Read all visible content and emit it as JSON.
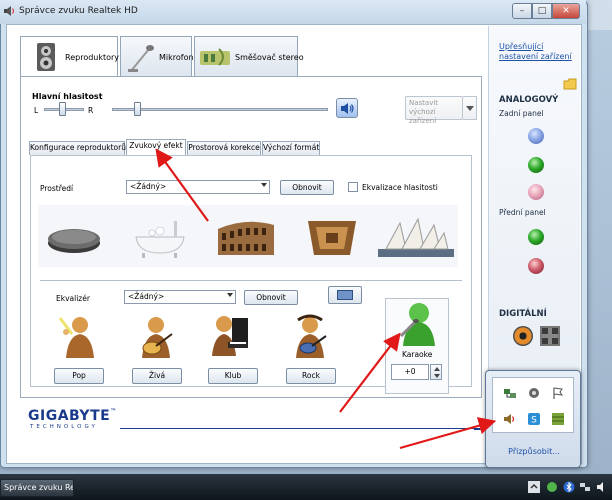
{
  "window": {
    "title": "Správce zvuku Realtek HD",
    "min_label": "–",
    "max_label": "□",
    "close_label": "✕"
  },
  "main_tabs": [
    {
      "label": "Reproduktory"
    },
    {
      "label": "Mikrofon"
    },
    {
      "label": "Směšovač stereo"
    }
  ],
  "volume": {
    "title": "Hlavní hlasitost",
    "left_label": "L",
    "right_label": "R",
    "default_device_button": "Nastavit výchozí zařízení"
  },
  "sub_tabs": [
    {
      "label": "Konfigurace reproduktorů"
    },
    {
      "label": "Zvukový efekt"
    },
    {
      "label": "Prostorová korekce"
    },
    {
      "label": "Výchozí formát"
    }
  ],
  "environment": {
    "label": "Prostředí",
    "selected": "<Žádný>",
    "reset_button": "Obnovit",
    "loudness_checkbox": "Ekvalizace hlasitosti"
  },
  "equalizer": {
    "label": "Ekvalizér",
    "selected": "<Žádný>",
    "reset_button": "Obnovit",
    "presets": [
      "Pop",
      "Živá",
      "Klub",
      "Rock"
    ],
    "karaoke_label": "Karaoke",
    "karaoke_value": "+0"
  },
  "right_panel": {
    "advanced_link": "Upřesňující nastavení zařízení",
    "analog_label": "ANALOGOVÝ",
    "rear_panel_label": "Zadní panel",
    "front_panel_label": "Přední panel",
    "digital_label": "DIGITÁLNÍ"
  },
  "brand": {
    "name": "GIGABYTE",
    "tm": "™",
    "sub": "TECHNOLOGY",
    "color": "#1a3a8c"
  },
  "tray_popup": {
    "customize_link": "Přizpůsobit..."
  },
  "taskbar": {
    "task_button": "Správce zvuku Realte..."
  },
  "colors": {
    "annotation_arrow": "#e01818",
    "link": "#1d52a8"
  }
}
